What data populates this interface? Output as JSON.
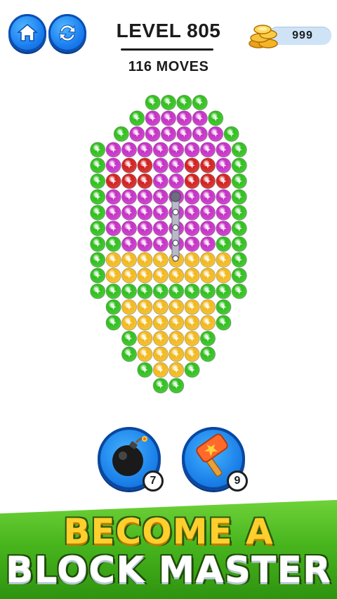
{
  "header": {
    "level_title": "LEVEL 805",
    "moves_text": "116 MOVES",
    "coins": "999",
    "home_icon": "home-icon",
    "restart_icon": "restart-icon",
    "coin_icon": "coin-stack-icon"
  },
  "board": {
    "shape": "balloon",
    "colors": {
      "G": "#2fbf1c",
      "P": "#c62fc6",
      "R": "#d11f1f",
      "Y": "#f2b81c"
    },
    "rows": [
      "...GGGG..",
      "..GPPPPG.",
      ".GPPPPPPG",
      "GPPPPPPPPG",
      "GPRRPPRRPG",
      "GRRRPPRRRG",
      "GPPPPPPPPG",
      "GPPPPPPPPG",
      "GPPPPPPPPG",
      "GGPPPPPPGG",
      "GYYYYYYYYG",
      "GYYYYYYYYG",
      "GGGGGGGGGG",
      ".GYYYYYYG.",
      ".GYYYYYYG.",
      "..GYYYYG..",
      "..GYYYYG..",
      "...GYYG...",
      "....GG...."
    ],
    "chain_icon": "chain-lock-icon"
  },
  "boosters": [
    {
      "name": "bomb",
      "icon": "bomb-icon",
      "count": "7"
    },
    {
      "name": "hammer",
      "icon": "hammer-icon",
      "count": "9"
    }
  ],
  "banner": {
    "line1": "BECOME A",
    "line2": "BLOCK MASTER"
  }
}
